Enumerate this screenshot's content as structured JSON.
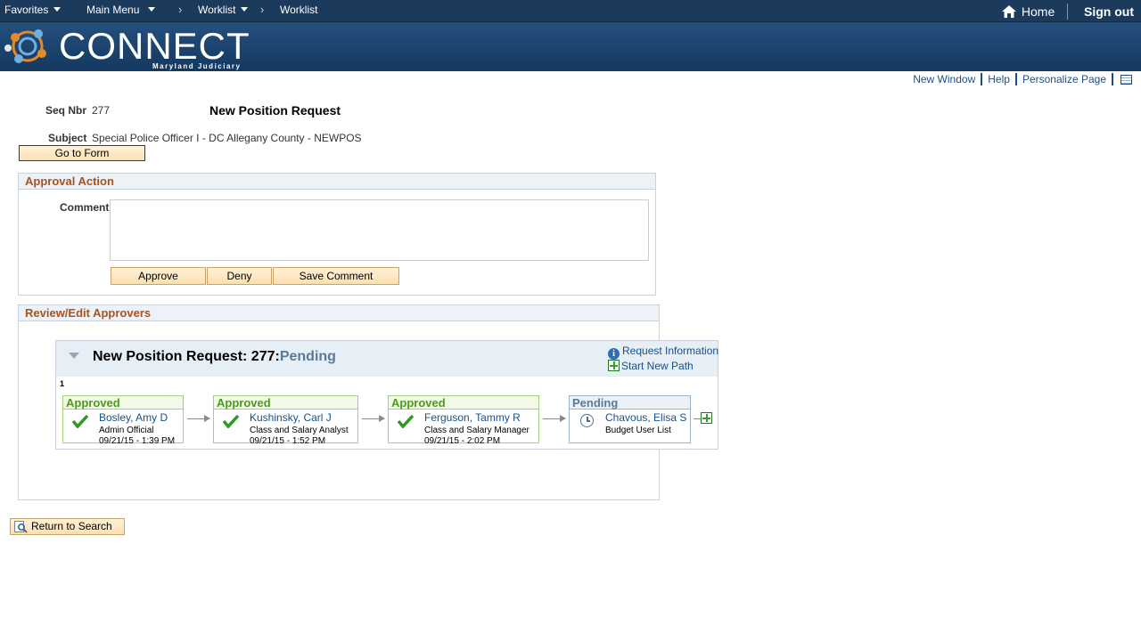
{
  "nav": {
    "favorites": "Favorites",
    "main_menu": "Main Menu",
    "breadcrumb": [
      "Worklist",
      "Worklist"
    ],
    "home": "Home",
    "sign_out": "Sign out"
  },
  "brand": {
    "logo_text": "CONNECT",
    "logo_sub": "Maryland Judiciary"
  },
  "util_links": {
    "new_window": "New Window",
    "help": "Help",
    "personalize": "Personalize Page"
  },
  "form": {
    "seq_label": "Seq Nbr",
    "seq_value": "277",
    "title": "New Position Request",
    "subject_label": "Subject",
    "subject_value": "Special Police Officer I - DC Allegany County - NEWPOS",
    "go_to_form": "Go to Form"
  },
  "approval_action": {
    "header": "Approval Action",
    "comment_label": "Comment",
    "comment_value": "",
    "approve": "Approve",
    "deny": "Deny",
    "save_comment": "Save Comment"
  },
  "review": {
    "header": "Review/Edit Approvers",
    "map_title": "New Position Request: 277:",
    "map_status": "Pending",
    "request_info": "Request Information",
    "start_new_path": "Start New Path",
    "path_number": "1",
    "steps": [
      {
        "status": "Approved",
        "name": "Bosley, Amy D",
        "role": "Admin Official",
        "date": "09/21/15 - 1:39 PM"
      },
      {
        "status": "Approved",
        "name": "Kushinsky, Carl J",
        "role": "Class and Salary Analyst",
        "date": "09/21/15 - 1:52 PM"
      },
      {
        "status": "Approved",
        "name": "Ferguson, Tammy R",
        "role": "Class and Salary Manager",
        "date": "09/21/15 - 2:02 PM"
      },
      {
        "status": "Pending",
        "name": "Chavous, Elisa S",
        "role": "Budget User List",
        "date": ""
      }
    ]
  },
  "return_to_search": "Return to Search",
  "colors": {
    "nav_bg": "#1b3a5c",
    "section_header_text": "#a8531d",
    "approved_green": "#4d9a1d",
    "link_blue": "#1a4f8a"
  }
}
